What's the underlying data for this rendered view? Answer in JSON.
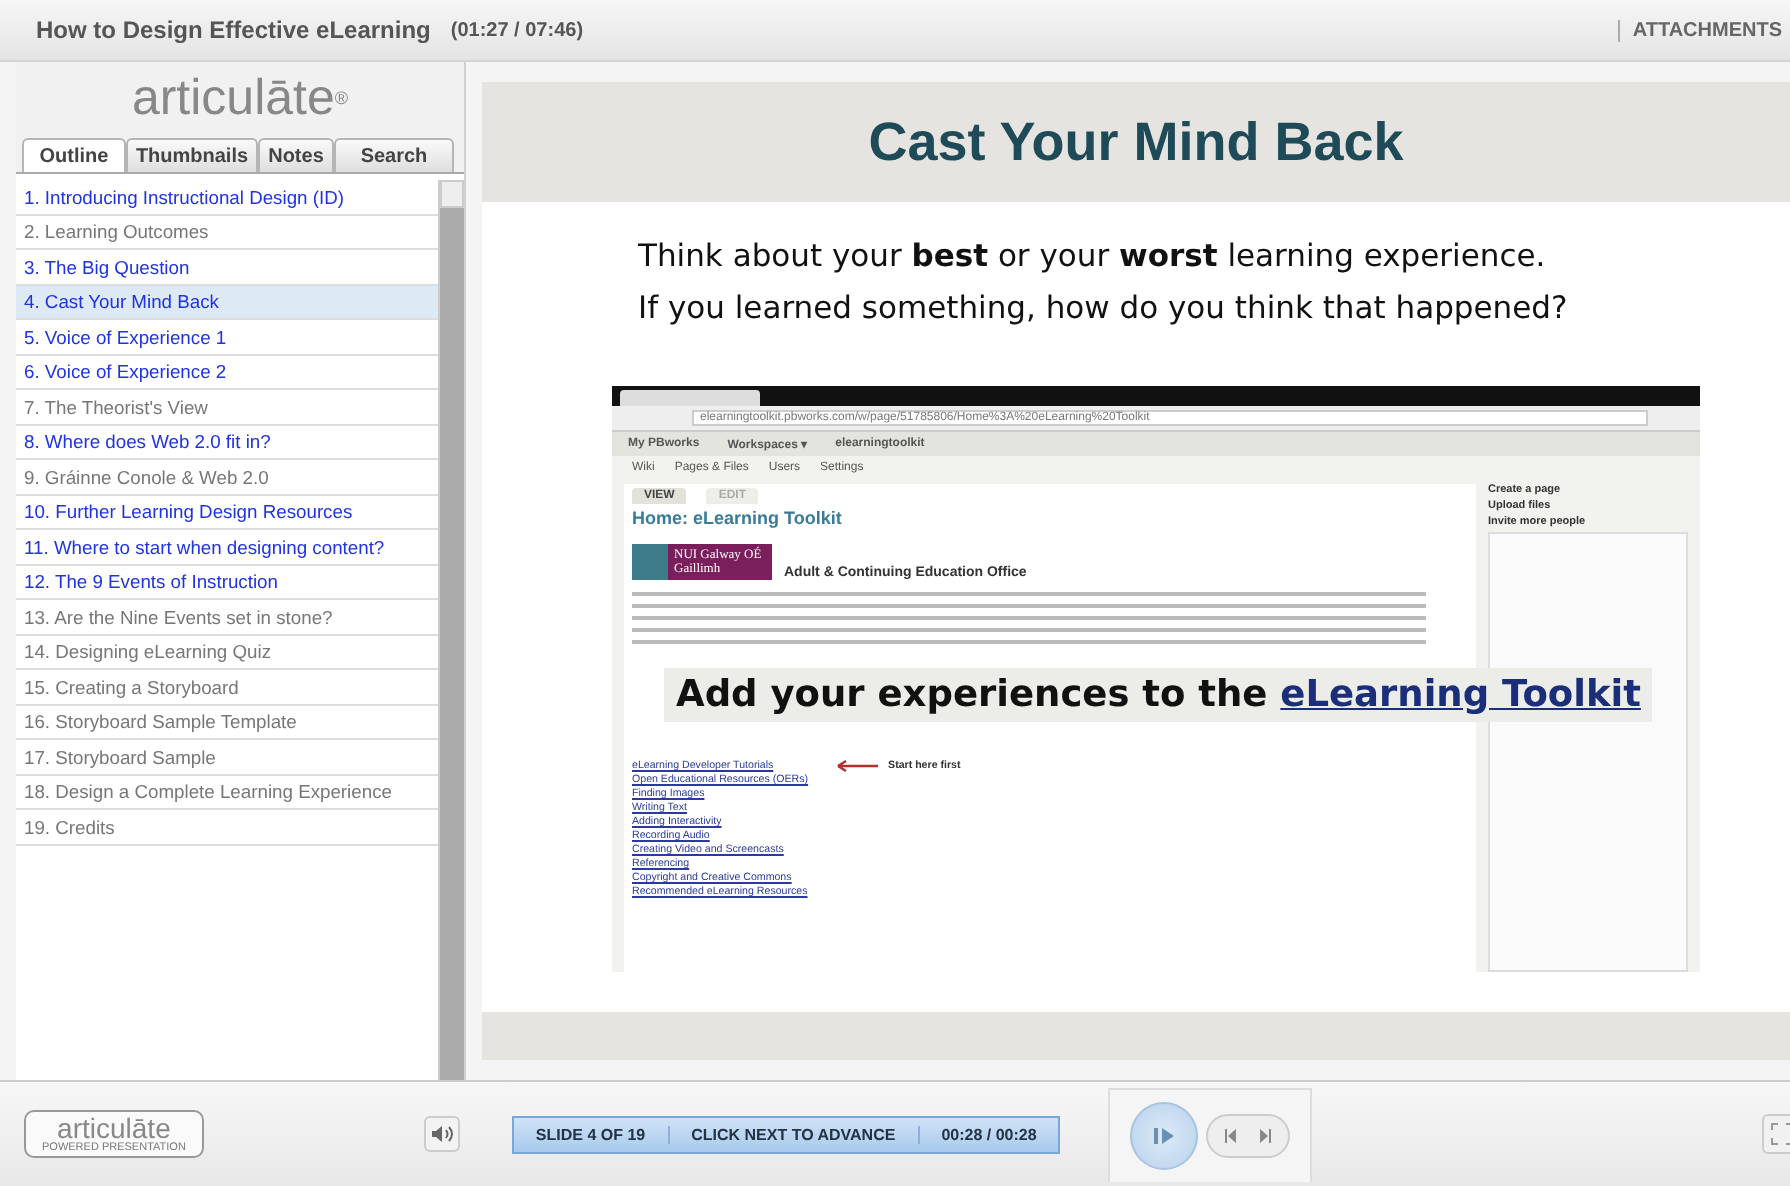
{
  "title_bar": {
    "title": "How to Design Effective eLearning",
    "time": "(01:27 / 07:46)",
    "attachments": "ATTACHMENTS"
  },
  "sidebar": {
    "logo": "articulāte$^{®}$",
    "tabs": [
      {
        "label": "Outline",
        "selected": true
      },
      {
        "label": "Thumbnails",
        "selected": false
      },
      {
        "label": "Notes",
        "selected": false
      },
      {
        "label": "Search",
        "selected": false
      }
    ],
    "items": [
      {
        "label": "1. Introducing Instructional Design (ID)",
        "viewed": true,
        "selected": false
      },
      {
        "label": "2. Learning Outcomes",
        "viewed": false,
        "selected": false
      },
      {
        "label": "3. The Big Question",
        "viewed": true,
        "selected": false
      },
      {
        "label": "4. Cast Your Mind Back",
        "viewed": true,
        "selected": true
      },
      {
        "label": "5. Voice of Experience 1",
        "viewed": true,
        "selected": false
      },
      {
        "label": "6. Voice of Experience 2",
        "viewed": true,
        "selected": false
      },
      {
        "label": "7. The Theorist's View",
        "viewed": false,
        "selected": false
      },
      {
        "label": "8. Where does Web 2.0 fit in?",
        "viewed": true,
        "selected": false
      },
      {
        "label": "9. Gráinne Conole & Web 2.0",
        "viewed": false,
        "selected": false
      },
      {
        "label": "10. Further Learning Design Resources",
        "viewed": true,
        "selected": false
      },
      {
        "label": "11. Where to start when designing content?",
        "viewed": true,
        "selected": false
      },
      {
        "label": "12. The 9 Events of Instruction",
        "viewed": true,
        "selected": false
      },
      {
        "label": "13. Are the Nine Events set in stone?",
        "viewed": false,
        "selected": false
      },
      {
        "label": "14. Designing eLearning Quiz",
        "viewed": false,
        "selected": false
      },
      {
        "label": "15. Creating a Storyboard",
        "viewed": false,
        "selected": false
      },
      {
        "label": "16. Storyboard Sample Template",
        "viewed": false,
        "selected": false
      },
      {
        "label": "17. Storyboard Sample",
        "viewed": false,
        "selected": false
      },
      {
        "label": "18. Design a Complete Learning Experience",
        "viewed": false,
        "selected": false
      },
      {
        "label": "19. Credits",
        "viewed": false,
        "selected": false
      }
    ]
  },
  "slide": {
    "title": "Cast Your Mind Back",
    "lines": [
      "Think about your **best** or your **worst** learning experience.",
      "If you learned something, how do you think that happened?"
    ],
    "screenshot": {
      "url": "elearningtoolkit.pbworks.com/w/page/51785806/Home%3A%20eLearning%20Toolkit",
      "nav": [
        "My PBworks",
        "Workspaces ▾",
        "elearningtoolkit"
      ],
      "toolbar": [
        "Wiki",
        "Pages & Files",
        "Users",
        "Settings"
      ],
      "tabs": [
        {
          "label": "VIEW",
          "selected": true
        },
        {
          "label": "EDIT",
          "selected": false
        }
      ],
      "heading": "Home: eLearning Toolkit",
      "logo": "NUI Galway OÉ Gaillimh",
      "office": "Adult & Continuing Education Office",
      "links": [
        "eLearning Developer Tutorials",
        "Open Educational Resources (OERs)",
        "Finding Images",
        "Writing Text",
        "Adding Interactivity",
        "Recording Audio",
        "Creating Video and Screencasts",
        "Referencing",
        "Copyright and Creative Commons",
        "Recommended eLearning Resources"
      ],
      "arrow_note": "Start here first",
      "side_actions": [
        "Create a page",
        "Upload files",
        "Invite more people"
      ],
      "overlay": "Add your experiences to the ",
      "overlay_link": "eLearning Toolkit"
    }
  },
  "player": {
    "logo": "articulāte",
    "logo_sub": "POWERED PRESENTATION",
    "slide_status": "SLIDE 4 OF 19",
    "hint": "CLICK NEXT TO ADVANCE",
    "time": "00:28 / 00:28"
  }
}
